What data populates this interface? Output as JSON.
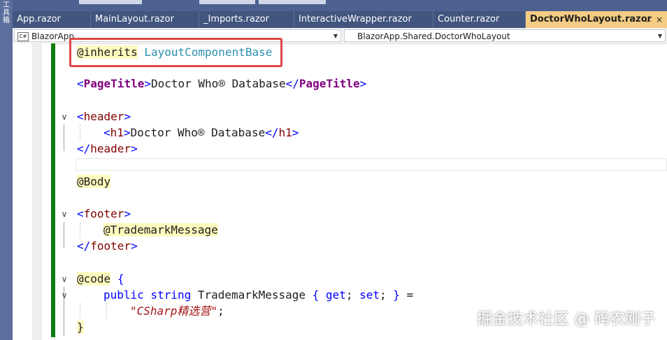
{
  "left_rail": {
    "text": "工具箱"
  },
  "tabs": [
    {
      "label": "App.razor",
      "active": false
    },
    {
      "label": "MainLayout.razor",
      "active": false
    },
    {
      "label": "_Imports.razor",
      "active": false
    },
    {
      "label": "InteractiveWrapper.razor",
      "active": false
    },
    {
      "label": "Counter.razor",
      "active": false
    },
    {
      "label": "DoctorWhoLayout.razor",
      "active": true
    }
  ],
  "active_tab": {
    "pin_glyph": "⊥",
    "close_glyph": "×"
  },
  "nav": {
    "project": "BlazorApp",
    "project_icon": "C#",
    "member": "BlazorApp.Shared.DoctorWhoLayout"
  },
  "code": {
    "inherits_directive": "@inherits",
    "inherits_type": "LayoutComponentBase",
    "pagetitle_tag": "PageTitle",
    "pagetitle_text": "Doctor Who® Database",
    "header_tag": "header",
    "h1_tag": "h1",
    "h1_text": "Doctor Who® Database",
    "body_directive": "@Body",
    "footer_tag": "footer",
    "trademark_expr": "@TrademarkMessage",
    "code_directive": "@code",
    "open_brace": "{",
    "close_brace": "}",
    "public_kw": "public",
    "string_kw": "string",
    "prop_name": "TrademarkMessage",
    "get_kw": "get",
    "set_kw": "set",
    "string_literal": "\"CSharp精选营\""
  },
  "watermark": {
    "text": "掘金技术社区 @ 码农刚子"
  },
  "colors": {
    "tab_bar": "#4d6191",
    "active_tab": "#f5cc84",
    "change_bar": "#107c10",
    "highlight_box": "#e04848"
  }
}
